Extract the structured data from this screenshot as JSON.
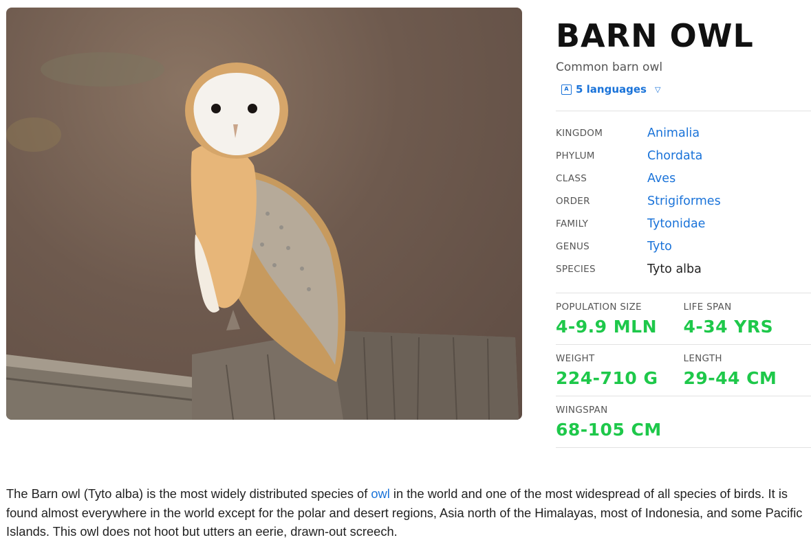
{
  "photo": {
    "alt": "Barn owl perched on a wooden fence post"
  },
  "header": {
    "title": "BARN OWL",
    "subtitle": "Common barn owl",
    "languages_label": "5 languages"
  },
  "taxonomy": [
    {
      "key": "KINGDOM",
      "value": "Animalia",
      "link": true
    },
    {
      "key": "PHYLUM",
      "value": "Chordata",
      "link": true
    },
    {
      "key": "CLASS",
      "value": "Aves",
      "link": true
    },
    {
      "key": "ORDER",
      "value": "Strigiformes",
      "link": true
    },
    {
      "key": "FAMILY",
      "value": "Tytonidae",
      "link": true
    },
    {
      "key": "GENUS",
      "value": "Tyto",
      "link": true
    },
    {
      "key": "SPECIES",
      "value": "Tyto alba",
      "link": false
    }
  ],
  "stats": {
    "population": {
      "key": "POPULATION SIZE",
      "value": "4-9.9 MLN"
    },
    "lifespan": {
      "key": "LIFE SPAN",
      "value": "4-34 YRS"
    },
    "weight": {
      "key": "WEIGHT",
      "value": "224-710 G"
    },
    "length": {
      "key": "LENGTH",
      "value": "29-44 CM"
    },
    "wingspan": {
      "key": "WINGSPAN",
      "value": "68-105 CM"
    }
  },
  "description": {
    "before": "The Barn owl (Tyto alba) is the most widely distributed species of ",
    "link": "owl",
    "after": " in the world and one of the most widespread of all species of birds. It is found almost everywhere in the world except for the polar and desert regions, Asia north of the Himalayas, most of Indonesia, and some Pacific Islands. This owl does not hoot but utters an eerie, drawn-out screech."
  },
  "colors": {
    "link": "#1a73d9",
    "stat_value": "#1ec84a"
  }
}
